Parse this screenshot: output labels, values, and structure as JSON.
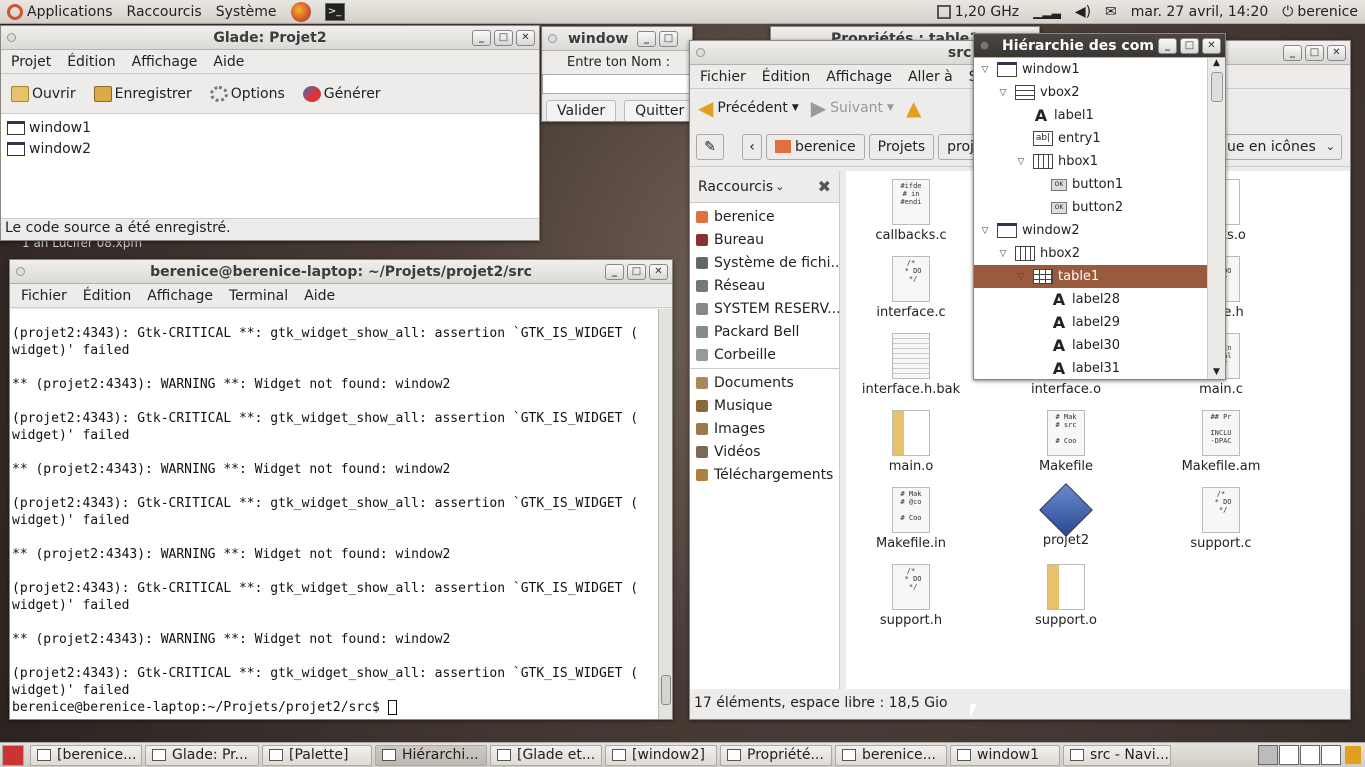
{
  "topbar": {
    "menus": [
      "Applications",
      "Raccourcis",
      "Système"
    ],
    "cpu": "1,20 GHz",
    "datetime": "mar. 27 avril, 14:20",
    "user": "berenice"
  },
  "glade": {
    "title": "Glade: Projet2",
    "menu": [
      "Projet",
      "Édition",
      "Affichage",
      "Aide"
    ],
    "toolbar": [
      "Ouvrir",
      "Enregistrer",
      "Options",
      "Générer"
    ],
    "items": [
      "window1",
      "window2"
    ],
    "status": "Le code source a été enregistré."
  },
  "window_small": {
    "title": "window",
    "label": "Entre ton Nom :",
    "buttons": [
      "Valider",
      "Quitter"
    ]
  },
  "props_title": "Propriétés : table1",
  "hierarchy": {
    "title": "Hiérarchie des com",
    "rows": [
      {
        "label": "window1",
        "icon": "window-icon"
      },
      {
        "label": "vbox2",
        "icon": "vbox-icon"
      },
      {
        "label": "label1",
        "icon": "label-icon"
      },
      {
        "label": "entry1",
        "icon": "entry-icon"
      },
      {
        "label": "hbox1",
        "icon": "hbox-icon"
      },
      {
        "label": "button1",
        "icon": "button-icon"
      },
      {
        "label": "button2",
        "icon": "button-icon"
      },
      {
        "label": "window2",
        "icon": "window-icon"
      },
      {
        "label": "hbox2",
        "icon": "hbox-icon"
      },
      {
        "label": "table1",
        "icon": "table-icon"
      },
      {
        "label": "label28",
        "icon": "label-icon"
      },
      {
        "label": "label29",
        "icon": "label-icon"
      },
      {
        "label": "label30",
        "icon": "label-icon"
      },
      {
        "label": "label31",
        "icon": "label-icon"
      }
    ],
    "selected": "table1"
  },
  "terminal": {
    "title": "berenice@berenice-laptop: ~/Projets/projet2/src",
    "menu": [
      "Fichier",
      "Édition",
      "Affichage",
      "Terminal",
      "Aide"
    ],
    "lines": [
      "(projet2:4343): Gtk-CRITICAL **: gtk_widget_show_all: assertion `GTK_IS_WIDGET (",
      "widget)' failed",
      "",
      "** (projet2:4343): WARNING **: Widget not found: window2",
      "",
      "(projet2:4343): Gtk-CRITICAL **: gtk_widget_show_all: assertion `GTK_IS_WIDGET (",
      "widget)' failed",
      "",
      "** (projet2:4343): WARNING **: Widget not found: window2",
      "",
      "(projet2:4343): Gtk-CRITICAL **: gtk_widget_show_all: assertion `GTK_IS_WIDGET (",
      "widget)' failed",
      "",
      "** (projet2:4343): WARNING **: Widget not found: window2",
      "",
      "(projet2:4343): Gtk-CRITICAL **: gtk_widget_show_all: assertion `GTK_IS_WIDGET (",
      "widget)' failed",
      "",
      "** (projet2:4343): WARNING **: Widget not found: window2",
      "",
      "(projet2:4343): Gtk-CRITICAL **: gtk_widget_show_all: assertion `GTK_IS_WIDGET (",
      "widget)' failed"
    ],
    "prompt": "berenice@berenice-laptop:~/Projets/projet2/src$"
  },
  "nautilus": {
    "title": "src - Navig",
    "menu": [
      "Fichier",
      "Édition",
      "Affichage",
      "Aller à",
      "Sig"
    ],
    "back": "Précédent",
    "forward": "Suivant",
    "path": [
      "berenice",
      "Projets",
      "proje"
    ],
    "view": "ue en icônes",
    "sidebar_title": "Raccourcis",
    "places": [
      "berenice",
      "Bureau",
      "Système de fichi...",
      "Réseau",
      "SYSTEM RESERV...",
      "Packard Bell",
      "Corbeille"
    ],
    "bookmarks": [
      "Documents",
      "Musique",
      "Images",
      "Vidéos",
      "Téléchargements"
    ],
    "files": [
      {
        "name": "callbacks.c",
        "preview": "#ifde\n# in\n#endi"
      },
      {
        "name": "interface.c",
        "preview": "/*\n * DO\n */"
      },
      {
        "name": "interface.h.bak",
        "preview": ""
      },
      {
        "name": "interface.o",
        "preview": ""
      },
      {
        "name": "main.o",
        "preview": ""
      },
      {
        "name": "Makefile",
        "preview": "# Mak\n# src\n\n# Coo"
      },
      {
        "name": "Makefile.in",
        "preview": "# Mak\n# @co\n\n# Coo"
      },
      {
        "name": "projet2",
        "preview": ""
      },
      {
        "name": "support.c",
        "preview": "/*\n * DO\n */"
      },
      {
        "name": "support.h",
        "preview": "/*\n * DO\n */"
      },
      {
        "name": "support.o",
        "preview": ""
      },
      {
        "name": "backs.o",
        "preview": ""
      },
      {
        "name": "rface.h",
        "preview": "/*\n * DO\n */"
      },
      {
        "name": "main.c",
        "preview": "/*\n * In\n * Gl\n */"
      },
      {
        "name": "Makefile.am",
        "preview": "## Pr\n\nINCLU\n-DPAC"
      }
    ],
    "status": "17 éléments, espace libre : 18,5 Gio"
  },
  "desktop_label": "1 an Lucifer 08.xpm",
  "taskbar": [
    "[berenice...",
    "Glade: Pr...",
    "[Palette]",
    "Hiérarchi...",
    "[Glade et...",
    "[window2]",
    "Propriété...",
    "berenice...",
    "window1",
    "src - Navi..."
  ]
}
